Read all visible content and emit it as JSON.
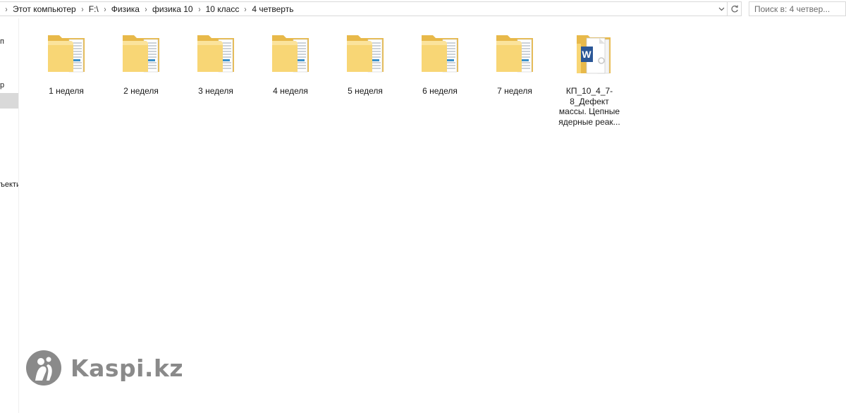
{
  "breadcrumbs": [
    "Этот компьютер",
    "F:\\",
    "Физика",
    "физика 10",
    "10 класс",
    "4 четверть"
  ],
  "search": {
    "placeholder": "Поиск в: 4 четвер..."
  },
  "nav": {
    "items": [
      {
        "label": "п"
      },
      {
        "label": "р"
      },
      {
        "label": "ъекти"
      }
    ]
  },
  "items": [
    {
      "type": "folder",
      "label": "1 неделя"
    },
    {
      "type": "folder",
      "label": "2 неделя"
    },
    {
      "type": "folder",
      "label": "3 неделя"
    },
    {
      "type": "folder",
      "label": "4 неделя"
    },
    {
      "type": "folder",
      "label": "5 неделя"
    },
    {
      "type": "folder",
      "label": "6 неделя"
    },
    {
      "type": "folder",
      "label": "7 неделя"
    },
    {
      "type": "folder-word",
      "label": "КП_10_4_7-8_Дефект массы. Цепные ядерные реак..."
    }
  ],
  "watermark": {
    "text": "Kaspi.kz"
  },
  "colors": {
    "folder_back": "#e8b94a",
    "folder_front": "#f8d675",
    "word_blue": "#2b5797",
    "selection": "#d9d9d9",
    "watermark": "#8a8a8a"
  }
}
